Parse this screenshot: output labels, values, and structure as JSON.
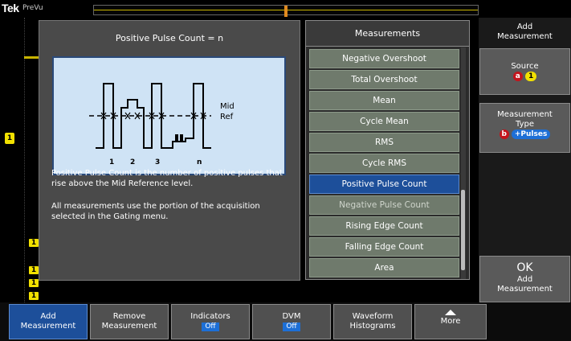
{
  "topbar": {
    "logo": "Tek",
    "logo_sub": "PreVu"
  },
  "channel_marker": "1",
  "help": {
    "title": "Positive Pulse Count = n",
    "diagram": {
      "label_mid": "Mid",
      "label_ref": "Ref",
      "pulse_labels": [
        "1",
        "2",
        "3",
        "n"
      ]
    },
    "text_1": "Positive Pulse Count is the number of positive pulses that rise above the Mid Reference level.",
    "text_2": "All measurements use the portion of the acquisition selected in the Gating menu."
  },
  "measurements": {
    "header": "Measurements",
    "items": [
      {
        "label": "Negative Overshoot"
      },
      {
        "label": "Total Overshoot"
      },
      {
        "label": "Mean"
      },
      {
        "label": "Cycle Mean"
      },
      {
        "label": "RMS"
      },
      {
        "label": "Cycle RMS"
      },
      {
        "label": "Positive Pulse Count"
      },
      {
        "label": "Negative Pulse Count"
      },
      {
        "label": "Rising Edge Count"
      },
      {
        "label": "Falling Edge Count"
      },
      {
        "label": "Area"
      }
    ],
    "selected": "Positive Pulse Count"
  },
  "side_menu": {
    "title_line1": "Add",
    "title_line2": "Measurement",
    "source_label": "Source",
    "source_badge": "a",
    "source_value": "1",
    "type_line1": "Measurement",
    "type_line2": "Type",
    "type_badge": "b",
    "type_value": "+Pulses",
    "ok_line1": "OK",
    "ok_line2": "Add",
    "ok_line3": "Measurement"
  },
  "bottom_menu": {
    "add_line1": "Add",
    "add_line2": "Measurement",
    "remove_line1": "Remove",
    "remove_line2": "Measurement",
    "indicators_label": "Indicators",
    "indicators_value": "Off",
    "dvm_label": "DVM",
    "dvm_value": "Off",
    "histograms_line1": "Waveform",
    "histograms_line2": "Histograms",
    "more_label": "More"
  },
  "waveform_markers": [
    "1",
    "1",
    "1",
    "1"
  ],
  "colors": {
    "selected_blue": "#1d4f9a",
    "channel_yellow": "#f2e100",
    "badge_red": "#c4141c"
  }
}
